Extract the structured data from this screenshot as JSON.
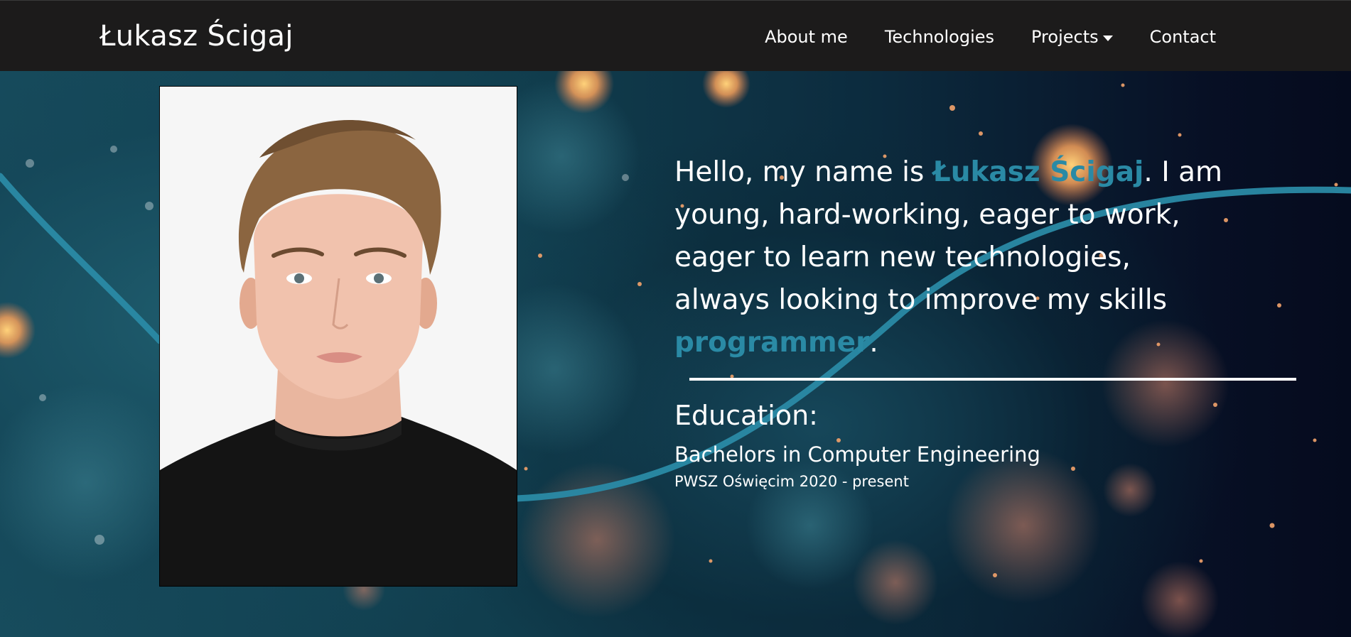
{
  "navbar": {
    "brand": "Łukasz Ścigaj",
    "links": [
      {
        "label": "About me"
      },
      {
        "label": "Technologies"
      },
      {
        "label": "Projects",
        "has_dropdown": true,
        "icon": "caret-down-icon"
      },
      {
        "label": "Contact"
      }
    ]
  },
  "profile": {
    "photo_alt": "Portrait photo"
  },
  "intro": {
    "p1": "Hello, my name is ",
    "name": "Łukasz Ścigaj",
    "p2": ". I am young, hard-working, eager to work, eager to learn new technologies, always looking to improve my skills ",
    "role": "programmer",
    "p3": "."
  },
  "education": {
    "title": "Education:",
    "degree": "Bachelors in Computer Engineering",
    "school": "PWSZ Oświęcim 2020 - present"
  },
  "colors": {
    "navbar_bg": "#1c1b1b",
    "accent": "#2a8aa5",
    "text": "#ffffff"
  }
}
